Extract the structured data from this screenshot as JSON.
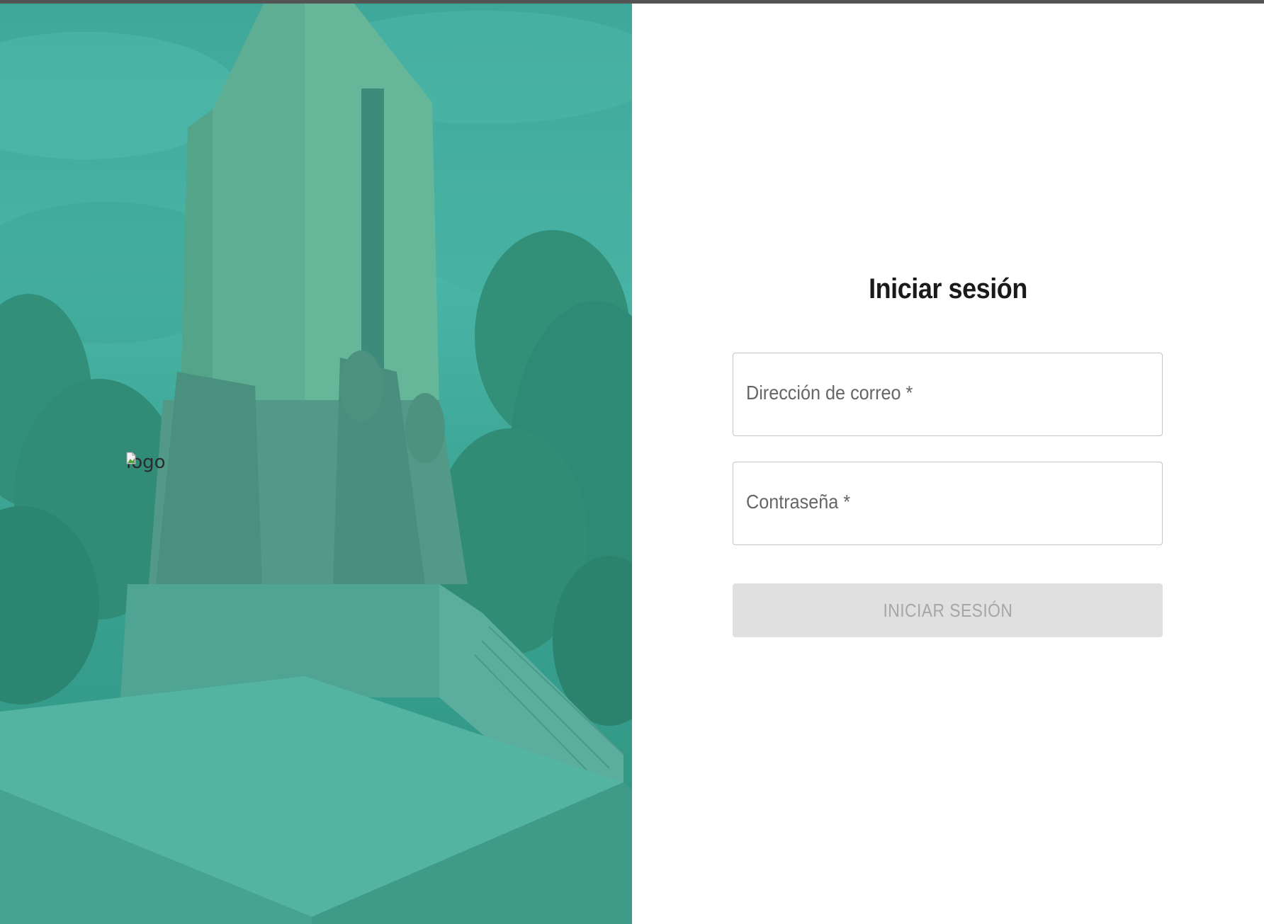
{
  "hero": {
    "logo_alt": "logo",
    "overlay_color": "#3fb6a3"
  },
  "login": {
    "title": "Iniciar sesión",
    "email_label": "Dirección de correo *",
    "email_value": "",
    "password_label": "Contraseña *",
    "password_value": "",
    "submit_label": "INICIAR SESIÓN",
    "submit_disabled": true
  },
  "colors": {
    "topbar": "#545454",
    "title": "#1a1a1a",
    "field_border": "#c4c4c4",
    "label": "#666666",
    "button_bg": "#e0e0e0",
    "button_text": "#a6a6a6"
  }
}
